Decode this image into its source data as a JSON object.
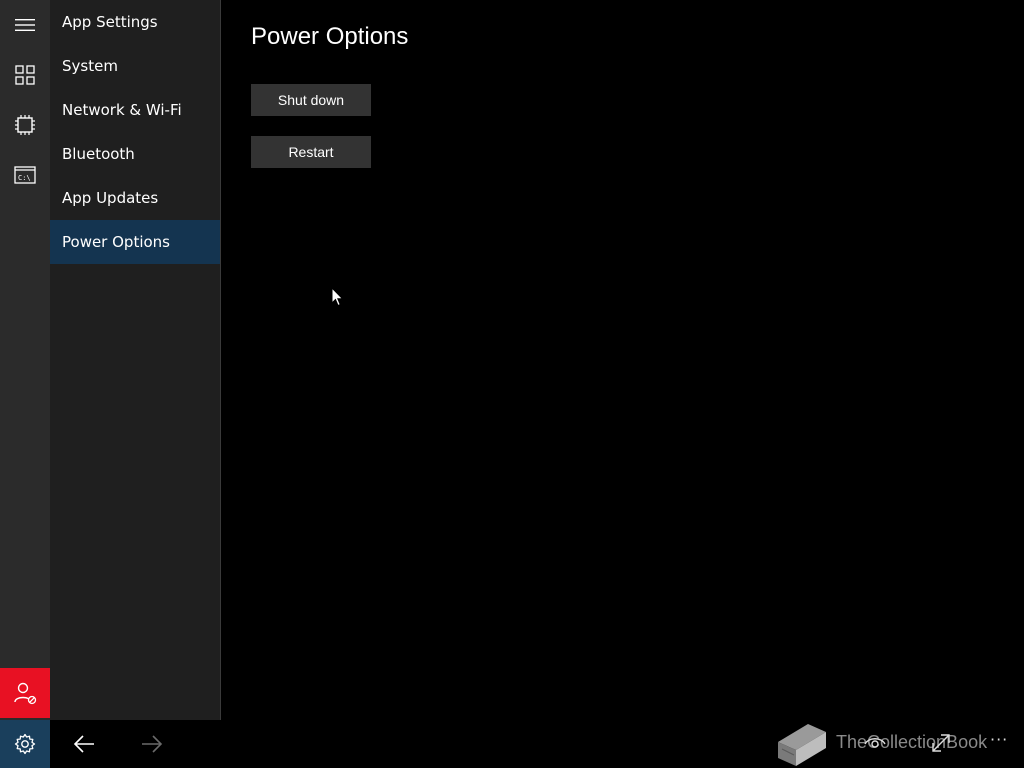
{
  "nav": {
    "items": [
      {
        "label": "App Settings",
        "selected": false
      },
      {
        "label": "System",
        "selected": false
      },
      {
        "label": "Network & Wi-Fi",
        "selected": false
      },
      {
        "label": "Bluetooth",
        "selected": false
      },
      {
        "label": "App Updates",
        "selected": false
      },
      {
        "label": "Power Options",
        "selected": true
      }
    ]
  },
  "rail": {
    "icons": [
      "hamburger-menu-icon",
      "apps-grid-icon",
      "processor-chip-icon",
      "command-prompt-icon"
    ],
    "command_prompt_glyph": "C:\\",
    "user_icon": "user-blocked-icon",
    "user_bg_color": "#e81123"
  },
  "content": {
    "title": "Power Options",
    "shutdown_label": "Shut down",
    "restart_label": "Restart"
  },
  "bottombar": {
    "settings_icon": "gear-icon",
    "back_icon": "back-arrow-icon",
    "forward_icon": "forward-arrow-icon",
    "watermark_text": "TheCollectionBook",
    "more_label": "···"
  },
  "colors": {
    "accent_selected": "#143450",
    "rail_bg": "#2b2b2b",
    "nav_bg": "#1f1f1f",
    "button_bg": "#333333"
  }
}
